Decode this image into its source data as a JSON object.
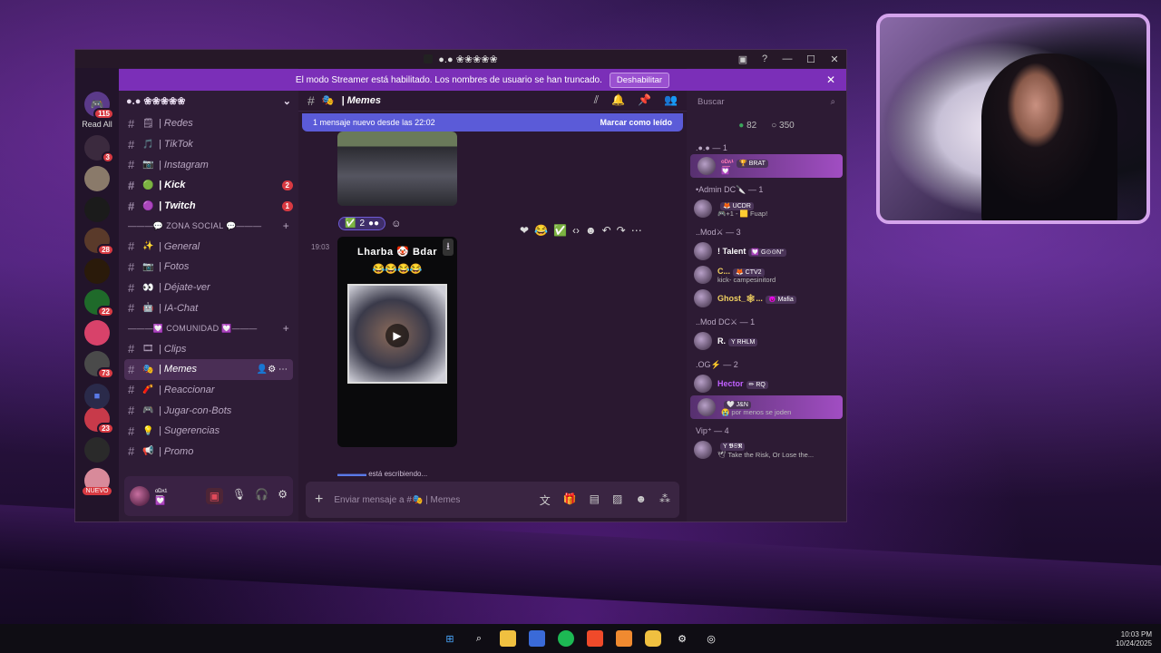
{
  "window": {
    "title": "●.● ❀❀❀❀❀"
  },
  "banner": {
    "text": "El modo Streamer está habilitado. Los nombres de usuario se han truncado.",
    "button": "Deshabilitar"
  },
  "guilds": {
    "read_all": "Read All",
    "home_badge": "115",
    "new_label": "NUEVO",
    "items": [
      {
        "name": "server-1",
        "color": "#3b2a3e",
        "badge": "3"
      },
      {
        "name": "server-2",
        "color": "#8a7a6a",
        "badge": ""
      },
      {
        "name": "server-3",
        "color": "#1b1b1b",
        "badge": ""
      },
      {
        "name": "server-4",
        "color": "#5a3a2a",
        "badge": "28"
      },
      {
        "name": "server-5",
        "color": "#2a1a0a",
        "badge": ""
      },
      {
        "name": "server-6",
        "color": "#1f6a2a",
        "badge": "22"
      },
      {
        "name": "server-7",
        "color": "#d8426a",
        "badge": ""
      },
      {
        "name": "server-8",
        "color": "#4a4a4a",
        "badge": "73"
      },
      {
        "name": "server-9",
        "color": "#c83a4a",
        "badge": "23"
      },
      {
        "name": "server-10",
        "color": "#2a2a2a",
        "badge": ""
      },
      {
        "name": "server-11",
        "color": "#d88a9a",
        "badge": ""
      }
    ]
  },
  "server": {
    "name": "●.● ❀❀❀❀❀"
  },
  "channels": [
    {
      "emoji": "🗒",
      "label": "| Redes",
      "bold": false,
      "badge": "",
      "active": false
    },
    {
      "emoji": "🎵",
      "label": "| TikTok",
      "bold": false,
      "badge": "",
      "active": false
    },
    {
      "emoji": "📷",
      "label": "| Instagram",
      "bold": false,
      "badge": "",
      "active": false
    },
    {
      "emoji": "🟢",
      "label": "| Kick",
      "bold": true,
      "badge": "2",
      "active": false
    },
    {
      "emoji": "🟣",
      "label": "| Twitch",
      "bold": true,
      "badge": "1",
      "active": false
    }
  ],
  "cat1": {
    "label": "———💬 ZONA SOCIAL 💬———"
  },
  "channels2": [
    {
      "emoji": "✨",
      "label": "| General"
    },
    {
      "emoji": "📷",
      "label": "| Fotos"
    },
    {
      "emoji": "👀",
      "label": "| Déjate-ver"
    },
    {
      "emoji": "🤖",
      "label": "| IA-Chat"
    }
  ],
  "cat2": {
    "label": "———💟 COMUNIDAD 💟———"
  },
  "channels3": [
    {
      "emoji": "🎞",
      "label": "| Clips",
      "active": false
    },
    {
      "emoji": "🎭",
      "label": "| Memes",
      "active": true
    },
    {
      "emoji": "🧨",
      "label": "| Reaccionar",
      "active": false
    },
    {
      "emoji": "🎮",
      "label": "| Jugar-con-Bots",
      "active": false
    },
    {
      "emoji": "💡",
      "label": "| Sugerencias",
      "active": false
    },
    {
      "emoji": "📢",
      "label": "| Promo",
      "active": false
    }
  ],
  "user": {
    "name": "ᵒ͟ᴰᶺ¹",
    "status": "💟"
  },
  "chat": {
    "channel": "Memes",
    "new_messages": "1 mensaje nuevo desde las 22:02",
    "mark_read": "Marcar como leído",
    "reaction_count": "2",
    "timestamp": "19:03",
    "image_header": "Lharba 🤡 Bdar",
    "image_emojis": "😂😂😂😂",
    "typing": "está escribiendo...",
    "placeholder": "Enviar mensaje a #🎭 | Memes"
  },
  "members": {
    "search": "Buscar",
    "online": "82",
    "offline": "350",
    "groups": [
      {
        "title": ".●.● — 1",
        "members": [
          {
            "name": "ᵒ͟ᴰᶺ¹",
            "color": "#ff7ab6",
            "tag": "🏆 BRAT",
            "sub": "💟",
            "hl": true
          }
        ]
      },
      {
        "title": "•Admin DC🔪 — 1",
        "members": [
          {
            "name": "",
            "color": "#c03030",
            "tag": "🦊 UCDR",
            "sub": "🎮+1 - 🟨 Fuap!",
            "hl": false
          }
        ]
      },
      {
        "title": "..Mod⚔ — 3",
        "members": [
          {
            "name": "! Talent",
            "color": "#ffffff",
            "tag": "💟 G⊙⊙N°",
            "sub": "",
            "hl": false
          },
          {
            "name": "C...",
            "color": "#f0d060",
            "tag": "🦊 CTV2",
            "sub": "kick- campesinitord",
            "hl": false
          },
          {
            "name": "Ghost_🕸...",
            "color": "#f0d060",
            "tag": "😈 Mafia",
            "sub": "",
            "hl": false
          }
        ]
      },
      {
        "title": "..Mod DC⚔ — 1",
        "members": [
          {
            "name": "R.",
            "color": "#ffffff",
            "tag": "Y RHLM",
            "sub": "",
            "hl": false
          }
        ]
      },
      {
        "title": ".OG⚡ — 2",
        "members": [
          {
            "name": "Hector",
            "color": "#c060ff",
            "tag": "✏ RQ",
            "sub": "",
            "hl": false
          },
          {
            "name": "",
            "color": "#ffffff",
            "tag": "🤍 J&N",
            "sub": "😭 por menos se joden",
            "hl": true
          }
        ]
      },
      {
        "title": "Vip⁺ — 4",
        "members": [
          {
            "name": "",
            "color": "#ffffff",
            "tag": "Y 𝕭𝕾𝕽",
            "sub": "🕊 Take the Risk, Or Lose the...",
            "hl": false
          }
        ]
      }
    ]
  },
  "clock": {
    "time": "10:03 PM",
    "date": "10/24/2025"
  }
}
